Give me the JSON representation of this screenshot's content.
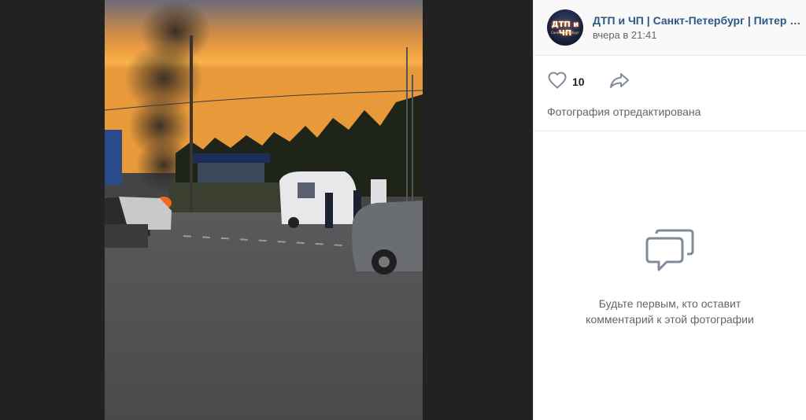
{
  "header": {
    "group_name": "ДТП и ЧП | Санкт-Петербург | Питер Онлайн | СПб",
    "post_time": "вчера в 21:41",
    "avatar_text": "ДТП и ЧП",
    "avatar_subtext": "Санкт-Петербург"
  },
  "actions": {
    "like_count": "10",
    "like_icon": "heart-icon",
    "share_icon": "share-arrow-icon"
  },
  "photo_status": "Фотография отредактирована",
  "comments": {
    "empty_icon": "comment-bubbles-icon",
    "empty_line1": "Будьте первым, кто оставит",
    "empty_line2": "комментарий к этой фотографии"
  },
  "colors": {
    "link": "#2a5885",
    "muted": "#656565",
    "icon": "#818c99",
    "viewer_bg": "#222222"
  }
}
